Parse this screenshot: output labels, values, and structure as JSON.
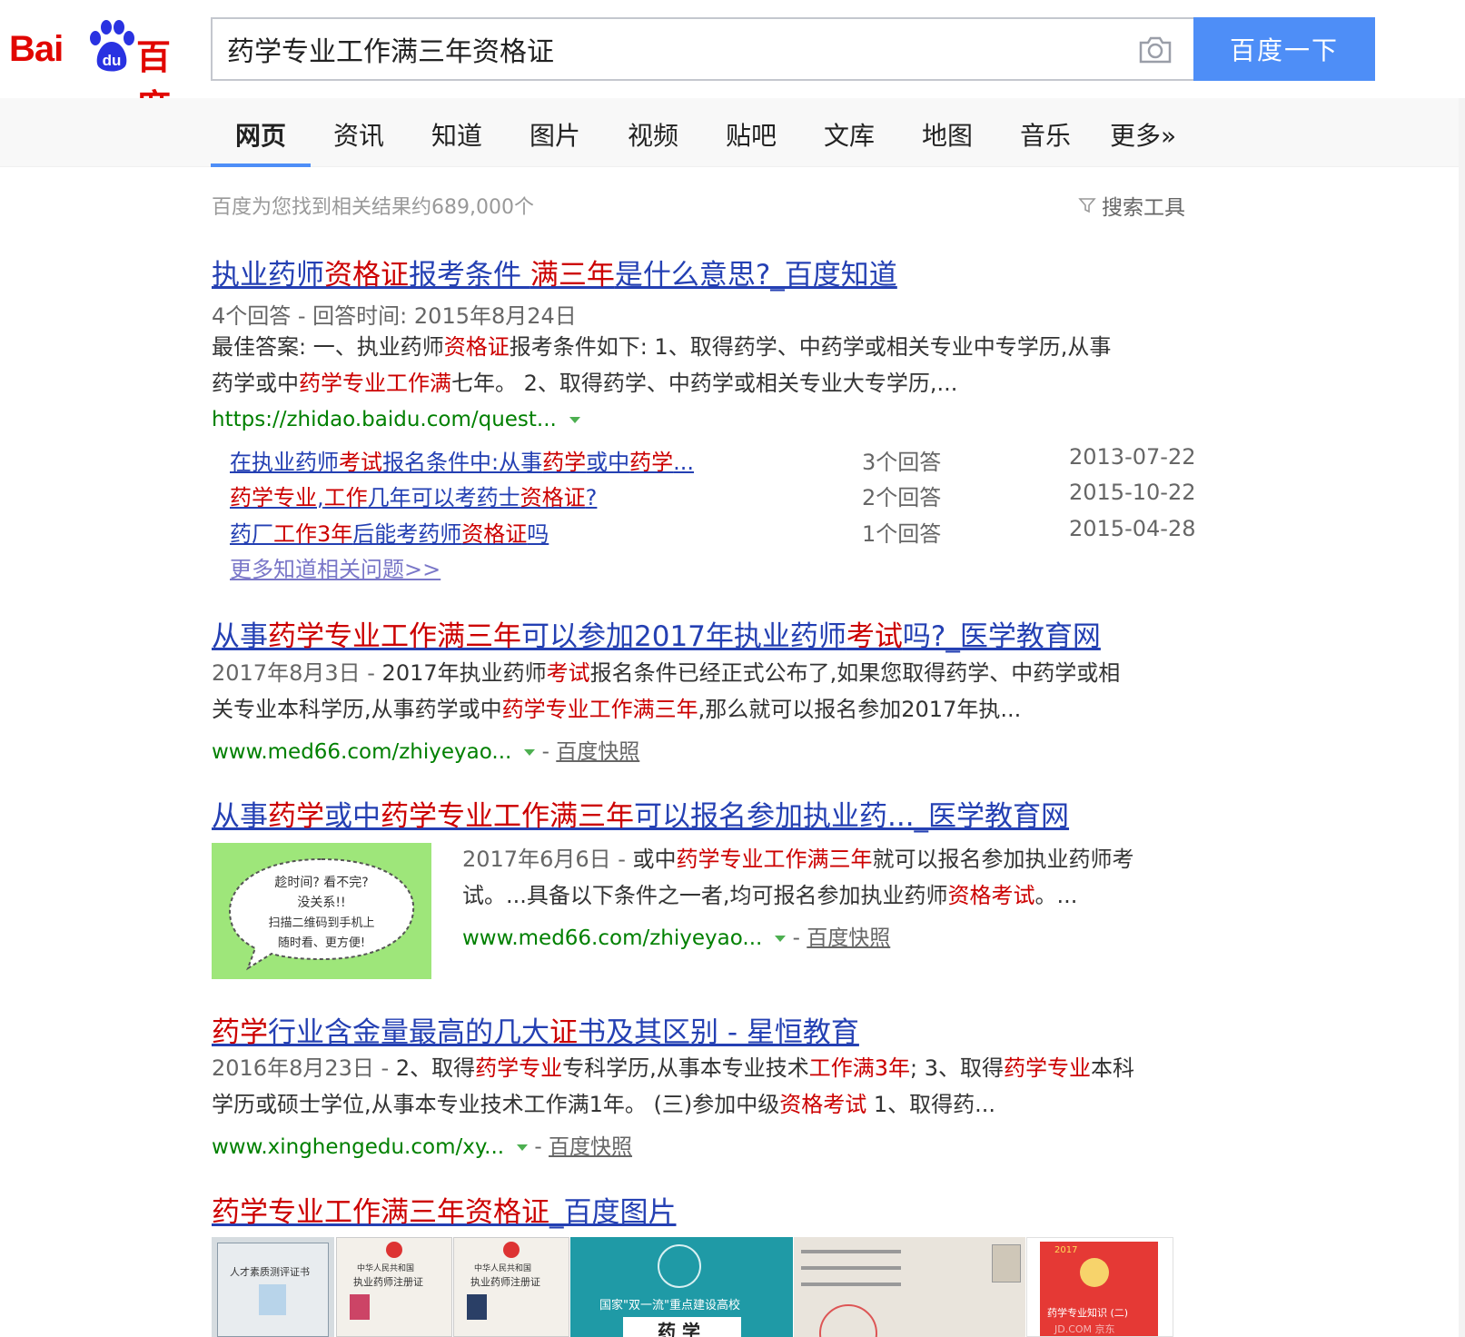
{
  "logo": {
    "text_latin": "Bai",
    "paw_text": "du",
    "text_cn": "百度"
  },
  "search": {
    "query": "药学专业工作满三年资格证",
    "button_label": "百度一下"
  },
  "nav": {
    "tabs": [
      "网页",
      "资讯",
      "知道",
      "图片",
      "视频",
      "贴吧",
      "文库",
      "地图",
      "音乐",
      "更多»"
    ],
    "active": "网页"
  },
  "result_count": "百度为您找到相关结果约689,000个",
  "search_tools": "搜索工具",
  "results": [
    {
      "title_parts": [
        [
          "执业药师",
          false
        ],
        [
          "资格证",
          true
        ],
        [
          "报考条件 ",
          false
        ],
        [
          "满三年",
          true
        ],
        [
          "是什么意思?_百度知道",
          false
        ]
      ],
      "meta": "4个回答 - 回答时间: 2015年8月24日",
      "abstract_lines": [
        [
          [
            "最佳答案: 一、执业药师",
            false
          ],
          [
            "资格证",
            true
          ],
          [
            "报考条件如下: 1、取得药学、中药学或相关专业中专学历,从事",
            false
          ]
        ],
        [
          [
            "药学或中",
            false
          ],
          [
            "药学专业工作满",
            true
          ],
          [
            "七年。 2、取得药学、中药学或相关专业大专学历,...",
            false
          ]
        ]
      ],
      "url": "https://zhidao.baidu.com/quest...",
      "sub_items": [
        {
          "parts": [
            [
              "在执业药师",
              false
            ],
            [
              "考试",
              true
            ],
            [
              "报名条件中:从事",
              false
            ],
            [
              "药学",
              true
            ],
            [
              "或中",
              false
            ],
            [
              "药学",
              true
            ],
            [
              "...",
              false
            ]
          ],
          "count": "3个回答",
          "date": "2013-07-22"
        },
        {
          "parts": [
            [
              "药学专业",
              true
            ],
            [
              ",",
              false
            ],
            [
              "工作",
              true
            ],
            [
              "几年可以考药士",
              false
            ],
            [
              "资格证",
              true
            ],
            [
              "?",
              false
            ]
          ],
          "count": "2个回答",
          "date": "2015-10-22"
        },
        {
          "parts": [
            [
              "药厂",
              false
            ],
            [
              "工作3年",
              true
            ],
            [
              "后能考药师",
              false
            ],
            [
              "资格证",
              true
            ],
            [
              "吗",
              false
            ]
          ],
          "count": "1个回答",
          "date": "2015-04-28"
        }
      ],
      "more_link": "更多知道相关问题>>"
    },
    {
      "title_parts": [
        [
          "从事",
          false
        ],
        [
          "药学专业工作满三年",
          true
        ],
        [
          "可以参加2017年执业药师",
          false
        ],
        [
          "考试",
          true
        ],
        [
          "吗?_医学教育网",
          false
        ]
      ],
      "abstract_lines": [
        [
          [
            "2017年8月3日 - ",
            "date"
          ],
          [
            "2017年执业药师",
            false
          ],
          [
            "考试",
            true
          ],
          [
            "报名条件已经正式公布了,如果您取得药学、中药学或相",
            false
          ]
        ],
        [
          [
            "关专业本科学历,从事药学或中",
            false
          ],
          [
            "药学专业工作满三年",
            true
          ],
          [
            ",那么就可以报名参加2017年执...",
            false
          ]
        ]
      ],
      "url": "www.med66.com/zhiyeyao...",
      "snapshot": "百度快照"
    },
    {
      "title_parts": [
        [
          "从事",
          false
        ],
        [
          "药学",
          true
        ],
        [
          "或中",
          false
        ],
        [
          "药学专业工作满三年",
          true
        ],
        [
          "可以报名参加执业药..._医学教育网",
          false
        ]
      ],
      "abstract_lines": [
        [
          [
            "2017年6月6日 - ",
            "date"
          ],
          [
            "或中",
            false
          ],
          [
            "药学专业工作满三年",
            true
          ],
          [
            "就可以报名参加执业药师考",
            false
          ]
        ],
        [
          [
            "试。...具备以下条件之一者,均可报名参加执业药师",
            false
          ],
          [
            "资格考试",
            true
          ],
          [
            "。...",
            false
          ]
        ]
      ],
      "url": "www.med66.com/zhiyeyao...",
      "snapshot": "百度快照",
      "thumb_text": [
        "趁时间? 看不完?",
        "没关系!!",
        "扫描二维码到手机上",
        "随时看、更方便!"
      ]
    },
    {
      "title_parts": [
        [
          "药学",
          true
        ],
        [
          "行业含金量最高的几大",
          false
        ],
        [
          "证",
          true
        ],
        [
          "书及其区别 - 星恒教育",
          false
        ]
      ],
      "abstract_lines": [
        [
          [
            "2016年8月23日 - ",
            "date"
          ],
          [
            "2、取得",
            false
          ],
          [
            "药学专业",
            true
          ],
          [
            "专科学历,从事本专业技术",
            false
          ],
          [
            "工作满3年",
            true
          ],
          [
            "; 3、取得",
            false
          ],
          [
            "药学专业",
            true
          ],
          [
            "本科",
            false
          ]
        ],
        [
          [
            "学历或硕士学位,从事本专业技术工作满1年。 (三)参加中级",
            false
          ],
          [
            "资格考试",
            true
          ],
          [
            " 1、取得药...",
            false
          ]
        ]
      ],
      "url": "www.xinghengedu.com/xy...",
      "snapshot": "百度快照"
    },
    {
      "title_parts": [
        [
          "药学专业工作满三年资格证",
          true
        ],
        [
          "_百度图片",
          false
        ]
      ]
    }
  ],
  "image_strip": {
    "tile1": "人才素质测评证书",
    "tile2_a": "中华人民共和国",
    "tile2_b": "执业药师注册证",
    "tile3_a": "中华人民共和国",
    "tile3_b": "执业药师注册证",
    "tile4_a": "国家\"双一流\"重点建设高校",
    "tile4_b": "药 学",
    "tile6_a": "2017",
    "tile6_b": "药学专业知识 (二)",
    "tile6_c": "JD.COM 京东"
  },
  "colors": {
    "accent": "#4e8ef7",
    "link": "#2440b3",
    "highlight": "#c00",
    "url": "#008000"
  }
}
